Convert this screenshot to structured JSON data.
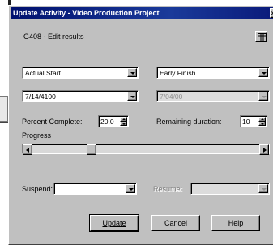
{
  "window": {
    "title": "Update Activity - Video Production Project",
    "subtitle": "G408 - Edit results"
  },
  "fields": {
    "start_type": "Actual Start",
    "finish_type": "Early Finish",
    "start_date": "7/14/4100",
    "finish_date": "7/04/00",
    "percent_complete_label": "Percent Complete:",
    "percent_complete_value": "20.0",
    "remaining_duration_label": "Remaining duration:",
    "remaining_duration_value": "10",
    "progress_label": "Progress",
    "progress_fraction": 0.2,
    "suspend_label": "Suspend:",
    "suspend_value": "",
    "resume_label": "Resume:",
    "resume_value": ""
  },
  "buttons": {
    "update": "Update",
    "cancel": "Cancel",
    "help": "Help"
  },
  "icons": {
    "calendar_settings": "columns-icon"
  }
}
